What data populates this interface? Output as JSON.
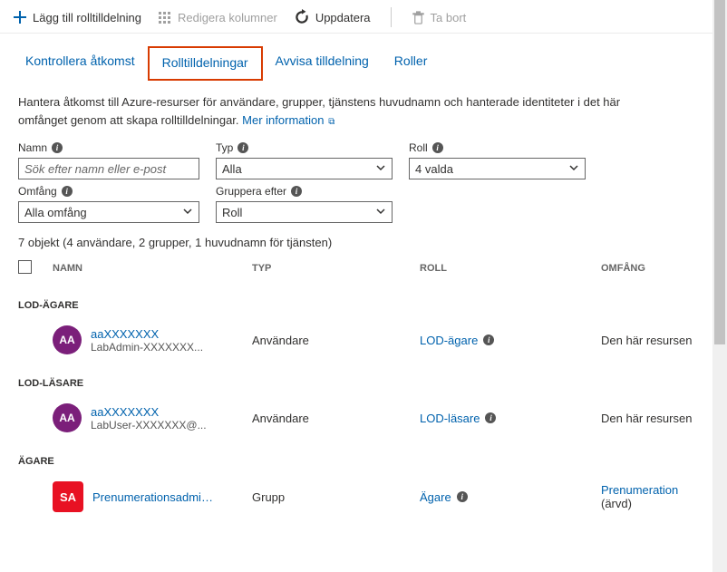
{
  "toolbar": {
    "add": "Lägg till rolltilldelning",
    "edit_columns": "Redigera kolumner",
    "refresh": "Uppdatera",
    "delete": "Ta bort"
  },
  "tabs": {
    "check_access": "Kontrollera åtkomst",
    "role_assignments": "Rolltilldelningar",
    "deny_assignments": "Avvisa tilldelning",
    "roles": "Roller"
  },
  "description": {
    "text": "Hantera åtkomst till Azure-resurser för användare, grupper, tjänstens huvudnamn och hanterade identiteter i det här omfånget genom att skapa rolltilldelningar. ",
    "link": "Mer information"
  },
  "filters": {
    "name_label": "Namn",
    "name_placeholder": "Sök efter namn eller e-post",
    "type_label": "Typ",
    "type_value": "Alla",
    "role_label": "Roll",
    "role_value": "4 valda",
    "scope_label": "Omfång",
    "scope_value": "Alla omfång",
    "group_by_label": "Gruppera efter",
    "group_by_value": "Roll"
  },
  "summary": "7 objekt (4 användare, 2 grupper, 1 huvudnamn för tjänsten)",
  "columns": {
    "name": "NAMN",
    "type": "TYP",
    "role": "ROLL",
    "scope": "OMFÅNG"
  },
  "groups": [
    {
      "title": "LOD-ÄGARE",
      "rows": [
        {
          "avatar": "AA",
          "avatarClass": "av-purple",
          "name": "aaXXXXXXX",
          "sub": "LabAdmin-XXXXXXX...",
          "type": "Användare",
          "role": "LOD-ägare",
          "scope": "Den här resursen",
          "scopeLink": false
        }
      ]
    },
    {
      "title": "LOD-LÄSARE",
      "rows": [
        {
          "avatar": "AA",
          "avatarClass": "av-purple",
          "name": "aaXXXXXXX",
          "sub": "LabUser-XXXXXXX@...",
          "type": "Användare",
          "role": "LOD-läsare",
          "scope": "Den här resursen",
          "scopeLink": false
        }
      ]
    },
    {
      "title": "ÄGARE",
      "rows": [
        {
          "avatar": "SA",
          "avatarClass": "av-red",
          "name": "Prenumerationsadmini...",
          "sub": "",
          "type": "Grupp",
          "role": "Ägare",
          "scope": "Prenumeration",
          "scopeSuffix": " (ärvd)",
          "scopeLink": true
        }
      ]
    }
  ]
}
